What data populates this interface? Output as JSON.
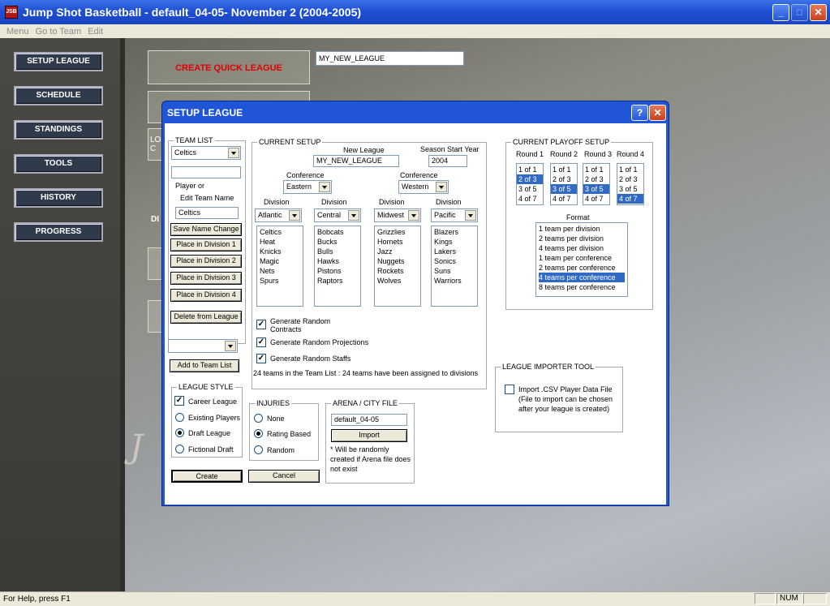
{
  "window": {
    "title": "Jump Shot Basketball - default_04-05- November 2 (2004-2005)",
    "icon_label": "JSB"
  },
  "menu": [
    "Menu",
    "Go to Team",
    "Edit"
  ],
  "nav": [
    "SETUP LEAGUE",
    "SCHEDULE",
    "STANDINGS",
    "TOOLS",
    "HISTORY",
    "PROGRESS"
  ],
  "background": {
    "quick_league": "CREATE QUICK LEAGUE",
    "league_name_value": "MY_NEW_LEAGUE",
    "partial_lo": "LO",
    "partial_c": "C",
    "partial_di": "DI"
  },
  "status": {
    "help": "For Help, press F1",
    "num": "NUM"
  },
  "dialog": {
    "title": "SETUP LEAGUE",
    "help_btn": "?",
    "close_btn": "✕",
    "team_list": {
      "legend": "TEAM LIST",
      "selected_team": "Celtics",
      "player_or": "Player or",
      "edit_team_name_label": "Edit Team Name",
      "edit_team_name_value": "Celtics",
      "buttons": [
        "Save Name Change",
        "Place in Division 1",
        "Place in Division 2",
        "Place in Division 3",
        "Place in Division 4",
        "Delete from League"
      ],
      "add_to_team_list": "Add to Team List"
    },
    "league_style": {
      "legend": "LEAGUE STYLE",
      "career_league": "Career League",
      "options": [
        "Existing Players",
        "Draft League",
        "Fictional Draft"
      ],
      "selected": "Draft League"
    },
    "current_setup": {
      "legend": "CURRENT SETUP",
      "new_league_label": "New League",
      "new_league_value": "MY_NEW_LEAGUE",
      "season_start_label": "Season Start Year",
      "season_start_value": "2004",
      "conference_label": "Conference",
      "conferences": [
        "Eastern",
        "Western"
      ],
      "division_label": "Division",
      "divisions": [
        {
          "name": "Atlantic",
          "teams": [
            "Celtics",
            "Heat",
            "Knicks",
            "Magic",
            "Nets",
            "Spurs"
          ]
        },
        {
          "name": "Central",
          "teams": [
            "Bobcats",
            "Bucks",
            "Bulls",
            "Hawks",
            "Pistons",
            "Raptors"
          ]
        },
        {
          "name": "Midwest",
          "teams": [
            "Grizzlies",
            "Hornets",
            "Jazz",
            "Nuggets",
            "Rockets",
            "Wolves"
          ]
        },
        {
          "name": "Pacific",
          "teams": [
            "Blazers",
            "Kings",
            "Lakers",
            "Sonics",
            "Suns",
            "Warriors"
          ]
        }
      ],
      "gen_contracts_1": "Generate Random",
      "gen_contracts_2": "Contracts",
      "gen_projections": "Generate Random Projections",
      "gen_staffs": "Generate Random Staffs",
      "summary": "24 teams in the Team List : 24 teams have been assigned to divisions"
    },
    "injuries": {
      "legend": "INJURIES",
      "options": [
        "None",
        "Rating Based",
        "Random"
      ],
      "selected": "Rating Based"
    },
    "arena": {
      "legend": "ARENA / CITY FILE",
      "file_value": "default_04-05",
      "import_btn": "Import",
      "note": "* Will be randomly created if Arena file does not exist"
    },
    "buttons": {
      "create": "Create",
      "cancel": "Cancel"
    },
    "playoff": {
      "legend": "CURRENT PLAYOFF SETUP",
      "rounds": [
        {
          "label": "Round 1",
          "options": [
            "1 of 1",
            "2 of 3",
            "3 of 5",
            "4 of 7"
          ],
          "selected": 1
        },
        {
          "label": "Round 2",
          "options": [
            "1 of 1",
            "2 of 3",
            "3 of 5",
            "4 of 7"
          ],
          "selected": 2
        },
        {
          "label": "Round 3",
          "options": [
            "1 of 1",
            "2 of 3",
            "3 of 5",
            "4 of 7"
          ],
          "selected": 2
        },
        {
          "label": "Round 4",
          "options": [
            "1 of 1",
            "2 of 3",
            "3 of 5",
            "4 of 7"
          ],
          "selected": 3
        }
      ],
      "format_label": "Format",
      "formats": [
        "1 team per division",
        "2 teams per division",
        "4 teams per division",
        "1 team per conference",
        "2 teams per conference",
        "4 teams per conference",
        "8 teams per conference"
      ],
      "format_selected": 5
    },
    "importer": {
      "legend": "LEAGUE IMPORTER TOOL",
      "text": "Import .CSV Player Data File  (File to import can be chosen after your league is created)"
    }
  }
}
